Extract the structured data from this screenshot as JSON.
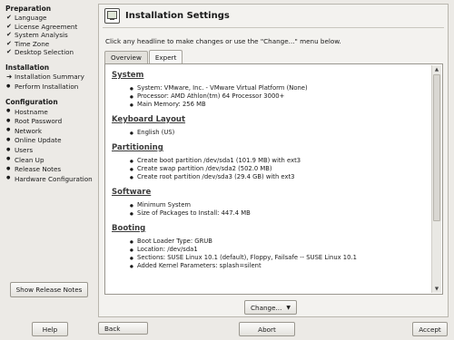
{
  "sidebar": {
    "sections": [
      {
        "title": "Preparation",
        "items": [
          {
            "label": "Language",
            "status": "check"
          },
          {
            "label": "License Agreement",
            "status": "check"
          },
          {
            "label": "System Analysis",
            "status": "check"
          },
          {
            "label": "Time Zone",
            "status": "check"
          },
          {
            "label": "Desktop Selection",
            "status": "check"
          }
        ]
      },
      {
        "title": "Installation",
        "items": [
          {
            "label": "Installation Summary",
            "status": "current"
          },
          {
            "label": "Perform Installation",
            "status": "pending"
          }
        ]
      },
      {
        "title": "Configuration",
        "items": [
          {
            "label": "Hostname",
            "status": "pending"
          },
          {
            "label": "Root Password",
            "status": "pending"
          },
          {
            "label": "Network",
            "status": "pending"
          },
          {
            "label": "Online Update",
            "status": "pending"
          },
          {
            "label": "Users",
            "status": "pending"
          },
          {
            "label": "Clean Up",
            "status": "pending"
          },
          {
            "label": "Release Notes",
            "status": "pending"
          },
          {
            "label": "Hardware Configuration",
            "status": "pending"
          }
        ]
      }
    ],
    "release_notes_button": "Show Release Notes"
  },
  "main": {
    "title": "Installation Settings",
    "title_icon": "monitor-icon",
    "instructions": "Click any headline to make changes or use the \"Change...\" menu below.",
    "tabs": [
      {
        "label": "Overview",
        "active": false
      },
      {
        "label": "Expert",
        "active": true
      }
    ],
    "sections": [
      {
        "title": "System",
        "items": [
          "System: VMware, Inc. - VMware Virtual Platform (None)",
          "Processor: AMD Athlon(tm) 64 Processor 3000+",
          "Main Memory: 256 MB"
        ]
      },
      {
        "title": "Keyboard Layout",
        "items": [
          "English (US)"
        ]
      },
      {
        "title": "Partitioning",
        "items": [
          "Create boot partition /dev/sda1 (101.9 MB) with ext3",
          "Create swap partition /dev/sda2 (502.0 MB)",
          "Create root partition /dev/sda3 (29.4 GB) with ext3"
        ]
      },
      {
        "title": "Software",
        "items": [
          "Minimum System",
          "Size of Packages to Install: 447.4 MB"
        ]
      },
      {
        "title": "Booting",
        "items": [
          "Boot Loader Type: GRUB",
          "Location: /dev/sda1",
          "Sections: SUSE Linux 10.1 (default), Floppy, Failsafe -- SUSE Linux 10.1",
          "Added Kernel Parameters: splash=silent"
        ]
      }
    ],
    "change_button": "Change..."
  },
  "buttons": {
    "help": "Help",
    "back": "Back",
    "abort": "Abort",
    "accept": "Accept"
  }
}
